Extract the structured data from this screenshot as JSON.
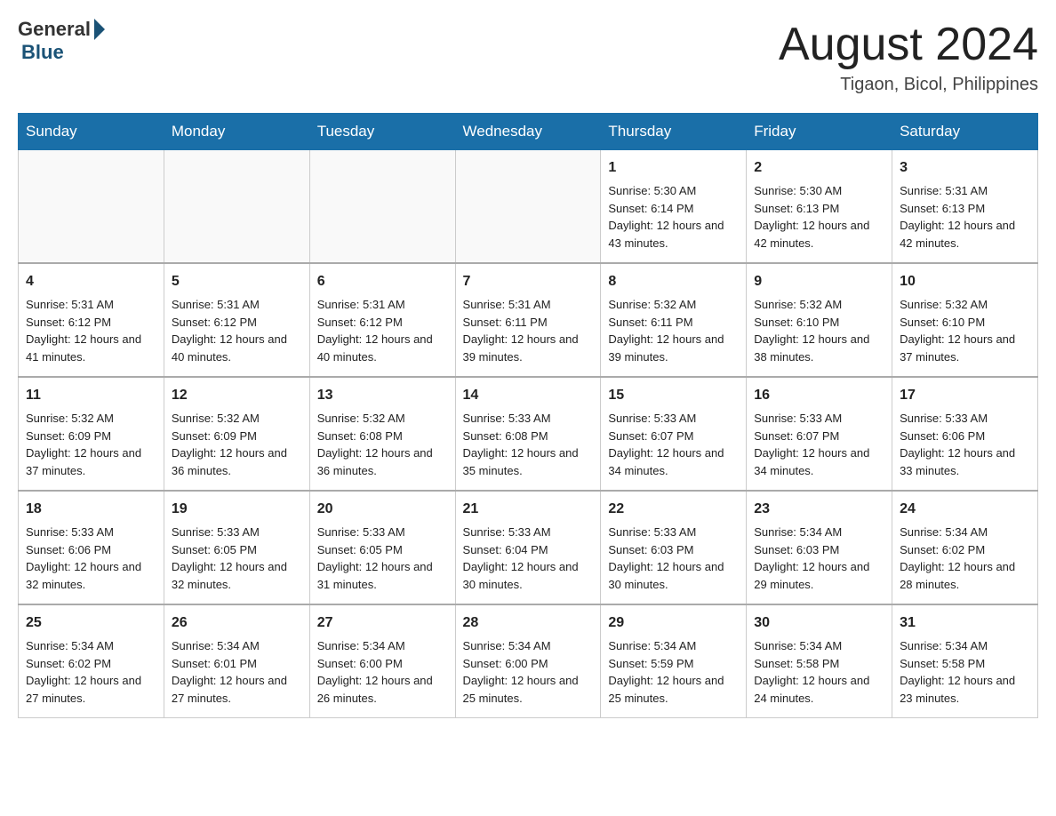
{
  "header": {
    "logo_general": "General",
    "logo_blue": "Blue",
    "month_title": "August 2024",
    "location": "Tigaon, Bicol, Philippines"
  },
  "days_of_week": [
    "Sunday",
    "Monday",
    "Tuesday",
    "Wednesday",
    "Thursday",
    "Friday",
    "Saturday"
  ],
  "weeks": [
    [
      {
        "day": "",
        "info": ""
      },
      {
        "day": "",
        "info": ""
      },
      {
        "day": "",
        "info": ""
      },
      {
        "day": "",
        "info": ""
      },
      {
        "day": "1",
        "info": "Sunrise: 5:30 AM\nSunset: 6:14 PM\nDaylight: 12 hours and 43 minutes."
      },
      {
        "day": "2",
        "info": "Sunrise: 5:30 AM\nSunset: 6:13 PM\nDaylight: 12 hours and 42 minutes."
      },
      {
        "day": "3",
        "info": "Sunrise: 5:31 AM\nSunset: 6:13 PM\nDaylight: 12 hours and 42 minutes."
      }
    ],
    [
      {
        "day": "4",
        "info": "Sunrise: 5:31 AM\nSunset: 6:12 PM\nDaylight: 12 hours and 41 minutes."
      },
      {
        "day": "5",
        "info": "Sunrise: 5:31 AM\nSunset: 6:12 PM\nDaylight: 12 hours and 40 minutes."
      },
      {
        "day": "6",
        "info": "Sunrise: 5:31 AM\nSunset: 6:12 PM\nDaylight: 12 hours and 40 minutes."
      },
      {
        "day": "7",
        "info": "Sunrise: 5:31 AM\nSunset: 6:11 PM\nDaylight: 12 hours and 39 minutes."
      },
      {
        "day": "8",
        "info": "Sunrise: 5:32 AM\nSunset: 6:11 PM\nDaylight: 12 hours and 39 minutes."
      },
      {
        "day": "9",
        "info": "Sunrise: 5:32 AM\nSunset: 6:10 PM\nDaylight: 12 hours and 38 minutes."
      },
      {
        "day": "10",
        "info": "Sunrise: 5:32 AM\nSunset: 6:10 PM\nDaylight: 12 hours and 37 minutes."
      }
    ],
    [
      {
        "day": "11",
        "info": "Sunrise: 5:32 AM\nSunset: 6:09 PM\nDaylight: 12 hours and 37 minutes."
      },
      {
        "day": "12",
        "info": "Sunrise: 5:32 AM\nSunset: 6:09 PM\nDaylight: 12 hours and 36 minutes."
      },
      {
        "day": "13",
        "info": "Sunrise: 5:32 AM\nSunset: 6:08 PM\nDaylight: 12 hours and 36 minutes."
      },
      {
        "day": "14",
        "info": "Sunrise: 5:33 AM\nSunset: 6:08 PM\nDaylight: 12 hours and 35 minutes."
      },
      {
        "day": "15",
        "info": "Sunrise: 5:33 AM\nSunset: 6:07 PM\nDaylight: 12 hours and 34 minutes."
      },
      {
        "day": "16",
        "info": "Sunrise: 5:33 AM\nSunset: 6:07 PM\nDaylight: 12 hours and 34 minutes."
      },
      {
        "day": "17",
        "info": "Sunrise: 5:33 AM\nSunset: 6:06 PM\nDaylight: 12 hours and 33 minutes."
      }
    ],
    [
      {
        "day": "18",
        "info": "Sunrise: 5:33 AM\nSunset: 6:06 PM\nDaylight: 12 hours and 32 minutes."
      },
      {
        "day": "19",
        "info": "Sunrise: 5:33 AM\nSunset: 6:05 PM\nDaylight: 12 hours and 32 minutes."
      },
      {
        "day": "20",
        "info": "Sunrise: 5:33 AM\nSunset: 6:05 PM\nDaylight: 12 hours and 31 minutes."
      },
      {
        "day": "21",
        "info": "Sunrise: 5:33 AM\nSunset: 6:04 PM\nDaylight: 12 hours and 30 minutes."
      },
      {
        "day": "22",
        "info": "Sunrise: 5:33 AM\nSunset: 6:03 PM\nDaylight: 12 hours and 30 minutes."
      },
      {
        "day": "23",
        "info": "Sunrise: 5:34 AM\nSunset: 6:03 PM\nDaylight: 12 hours and 29 minutes."
      },
      {
        "day": "24",
        "info": "Sunrise: 5:34 AM\nSunset: 6:02 PM\nDaylight: 12 hours and 28 minutes."
      }
    ],
    [
      {
        "day": "25",
        "info": "Sunrise: 5:34 AM\nSunset: 6:02 PM\nDaylight: 12 hours and 27 minutes."
      },
      {
        "day": "26",
        "info": "Sunrise: 5:34 AM\nSunset: 6:01 PM\nDaylight: 12 hours and 27 minutes."
      },
      {
        "day": "27",
        "info": "Sunrise: 5:34 AM\nSunset: 6:00 PM\nDaylight: 12 hours and 26 minutes."
      },
      {
        "day": "28",
        "info": "Sunrise: 5:34 AM\nSunset: 6:00 PM\nDaylight: 12 hours and 25 minutes."
      },
      {
        "day": "29",
        "info": "Sunrise: 5:34 AM\nSunset: 5:59 PM\nDaylight: 12 hours and 25 minutes."
      },
      {
        "day": "30",
        "info": "Sunrise: 5:34 AM\nSunset: 5:58 PM\nDaylight: 12 hours and 24 minutes."
      },
      {
        "day": "31",
        "info": "Sunrise: 5:34 AM\nSunset: 5:58 PM\nDaylight: 12 hours and 23 minutes."
      }
    ]
  ]
}
